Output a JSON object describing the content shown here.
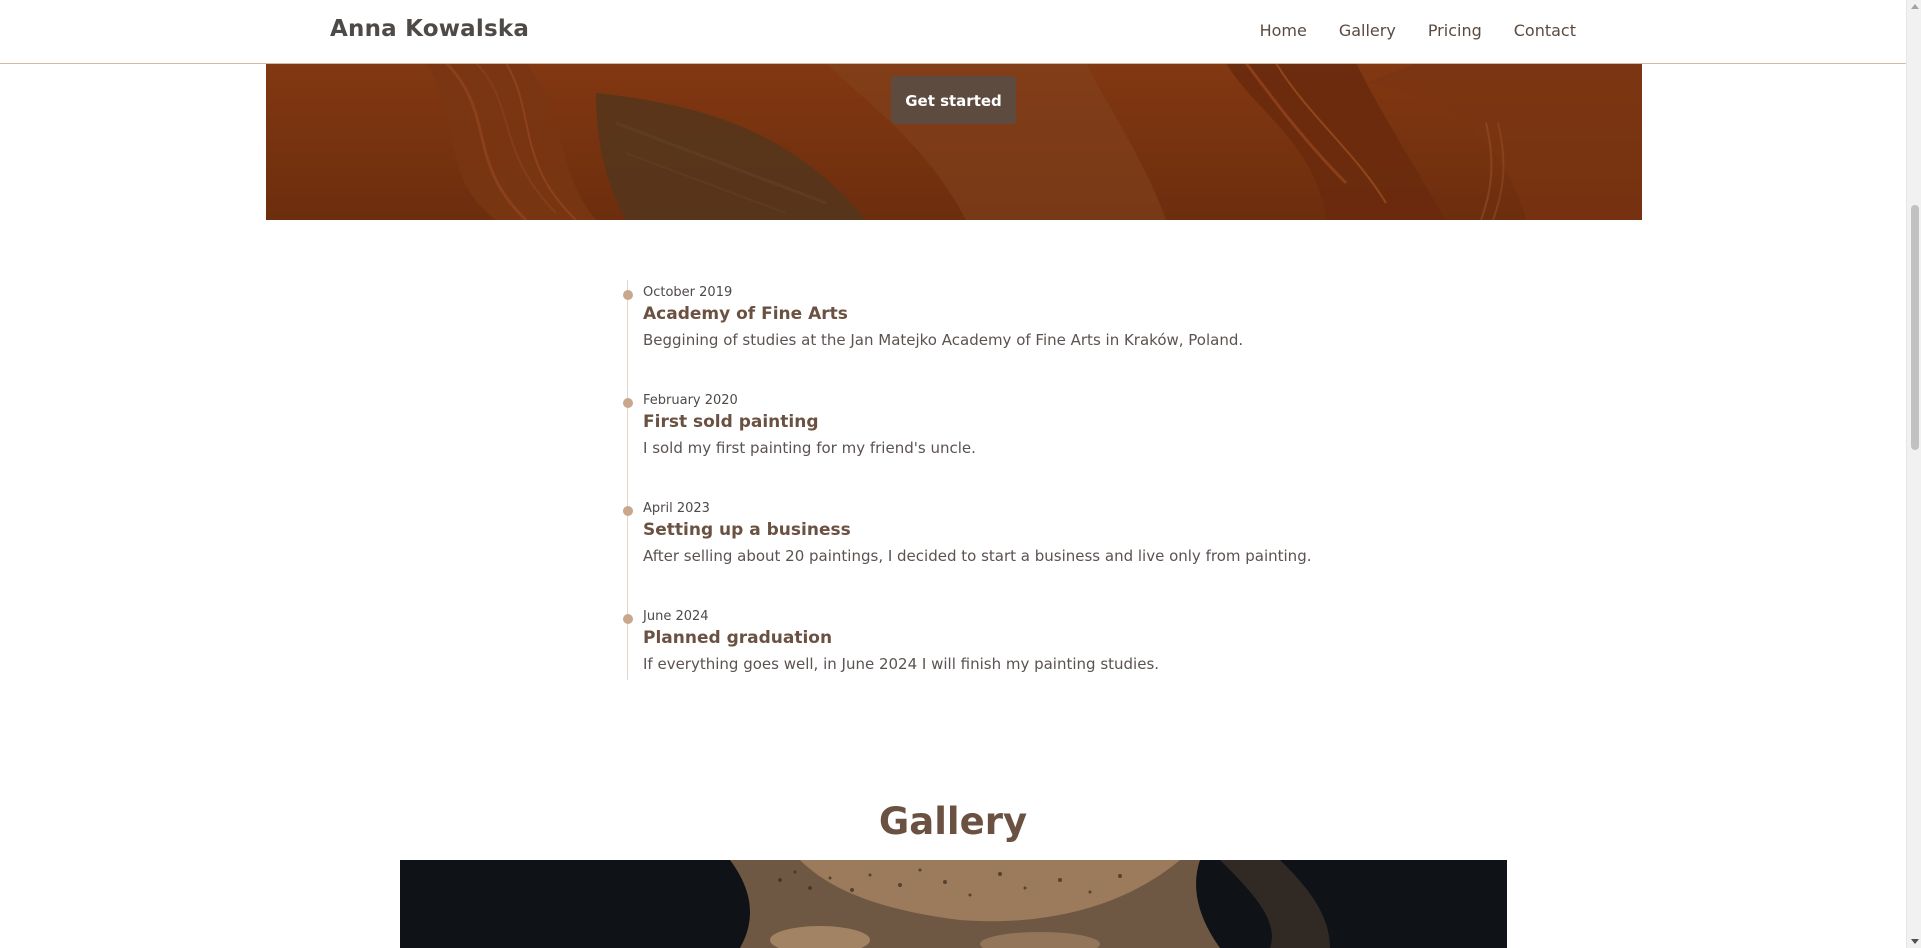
{
  "navbar": {
    "brand": "Anna Kowalska",
    "links": [
      "Home",
      "Gallery",
      "Pricing",
      "Contact"
    ]
  },
  "hero": {
    "button_label": "Get started"
  },
  "timeline": {
    "items": [
      {
        "date": "October 2019",
        "title": "Academy of Fine Arts",
        "text": "Beggining of studies at the Jan Matejko Academy of Fine Arts in Kraków, Poland."
      },
      {
        "date": "February 2020",
        "title": "First sold painting",
        "text": "I sold my first painting for my friend's uncle."
      },
      {
        "date": "April 2023",
        "title": "Setting up a business",
        "text": "After selling about 20 paintings, I decided to start a business and live only from painting."
      },
      {
        "date": "June 2024",
        "title": "Planned graduation",
        "text": "If everything goes well, in June 2024 I will finish my painting studies."
      }
    ]
  },
  "gallery": {
    "heading": "Gallery"
  },
  "colors": {
    "accent": "#6b5142",
    "button": "#5e4b3f",
    "hero_overlay": "#7a3510",
    "timeline_dot": "#c9a78c"
  }
}
